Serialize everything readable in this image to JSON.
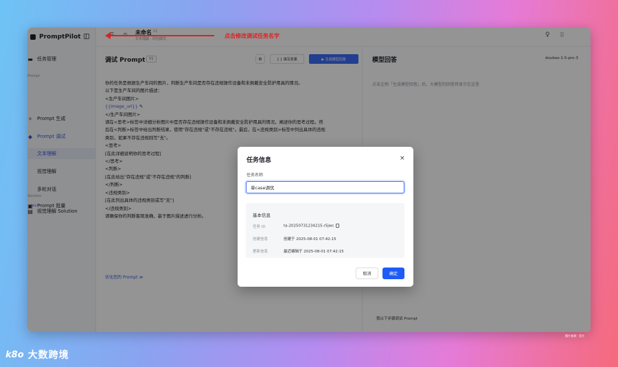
{
  "app": {
    "name": "PromptPilot"
  },
  "sidebar": {
    "items": [
      {
        "label": "任务管理"
      },
      {
        "label": "Prompt 生成"
      },
      {
        "label": "Prompt 调试"
      },
      {
        "label": "文本理解"
      },
      {
        "label": "视觉理解"
      },
      {
        "label": "多轮对话"
      },
      {
        "label": "Prompt 批量"
      },
      {
        "label": "视觉理解 Solution"
      }
    ],
    "group_labels": [
      "Prompt",
      "Solution"
    ],
    "beta_badge": "Beta"
  },
  "topbar": {
    "task_title": "未命名",
    "task_version": "V1",
    "task_subtitle": "文本理解 · 评估模式",
    "annotation": "点击修改调试任务名字"
  },
  "editor": {
    "title": "调试 Prompt",
    "version_badge": "V1",
    "buttons": {
      "variables": "{ } 填写变量",
      "generate": "▶ 生成模型回答"
    },
    "prompt_lines": [
      "你的任务是根据生产车间的图片，判断生产车间是否存在违规操作设备和未佩戴安全防护用具的情况。",
      "以下是生产车间的图片描述：",
      "<生产车间图片>",
      "{{image_url}}",
      "</生产车间图片>",
      "请在<思考>标签中详细分析图片中是否存在违规操作设备和未佩戴安全防护用具的情况，阐述你的思考过程。然",
      "后在<判断>标签中给出判断结果，使用\"存在违规\"或\"不存在违规\"。最后，在<违规类别>标签中列出具体的违规",
      "类别，如果不存在违规则写\"无\"。",
      "<思考>",
      "[在此详细说明你的思考过程]",
      "</思考>",
      "<判断>",
      "[在此给出\"存在违规\"或\"不存在违规\"的判断]",
      "</判断>",
      "<违规类别>",
      "[在此列出具体的违规类别或写\"无\"]",
      "</违规类别>",
      "请确保你的判断客观准确，基于图片描述进行分析。"
    ],
    "optimize_link": "优化您的 Prompt ≫"
  },
  "response": {
    "title": "模型回答",
    "model": "doubao-1.5-pro-3",
    "empty_hint": "点击左侧「生成模型回答」后，大模型的回答将显示在这里",
    "footer": "我以下步骤调试 Prompt"
  },
  "modal": {
    "title": "任务信息",
    "field_label": "任务名称",
    "field_value": "单case调优",
    "info_title": "基本信息",
    "rows": [
      {
        "label": "任务 ID",
        "value": "ta-20250731234215-r5jws"
      },
      {
        "label": "创建信息",
        "value": "创建于 2025-08-01 07:42:15"
      },
      {
        "label": "更新信息",
        "value": "最近编辑于 2025-08-01 07:42:15"
      }
    ],
    "cancel": "取消",
    "ok": "确定"
  },
  "watermark": {
    "logo": "k8o",
    "text": "大数跨境"
  },
  "corner_note": "图片来源：官方"
}
